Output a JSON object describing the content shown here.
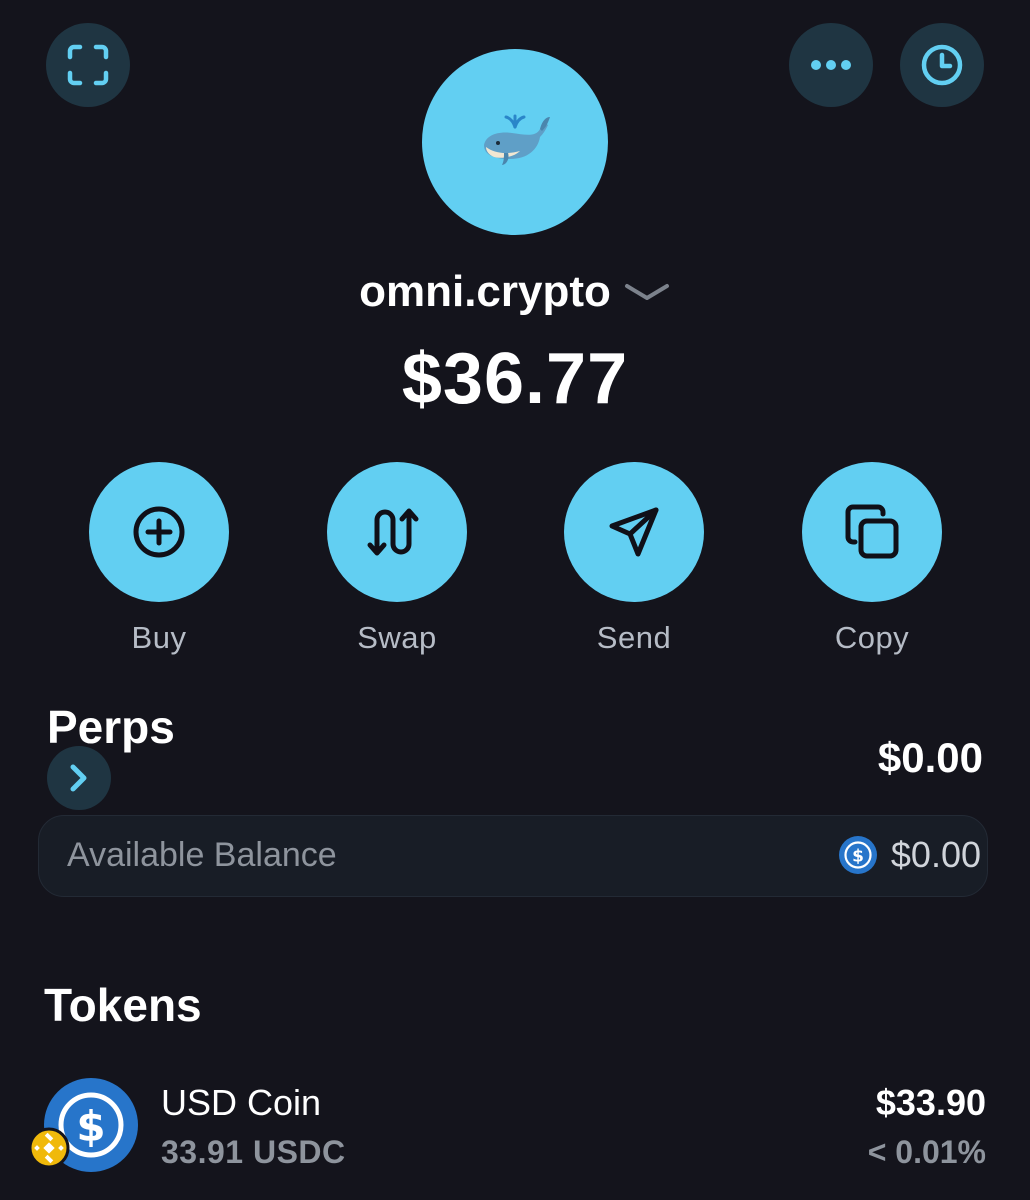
{
  "header": {
    "scan_icon": "scan-icon",
    "more_icon": "more-icon",
    "history_icon": "clock-icon"
  },
  "account": {
    "avatar_icon": "whale-icon",
    "name": "omni.crypto",
    "dropdown_icon": "chevron-down-icon",
    "total_balance": "$36.77"
  },
  "actions": [
    {
      "label": "Buy",
      "icon": "plus-circle-icon"
    },
    {
      "label": "Swap",
      "icon": "swap-arrows-icon"
    },
    {
      "label": "Send",
      "icon": "send-icon"
    },
    {
      "label": "Copy",
      "icon": "copy-icon"
    }
  ],
  "perps": {
    "title": "Perps",
    "value": "$0.00",
    "available_label": "Available Balance",
    "available_value": "$0.00"
  },
  "tokens": {
    "title": "Tokens",
    "items": [
      {
        "name": "USD Coin",
        "amount": "33.91 USDC",
        "value": "$33.90",
        "change": "< 0.01%",
        "icon": "usdc-icon",
        "chain_badge": "bnb-chain-icon"
      }
    ]
  },
  "colors": {
    "background": "#14141c",
    "accent": "#62cff2",
    "button_dark": "#1f3542",
    "muted_text": "#8e949d"
  }
}
